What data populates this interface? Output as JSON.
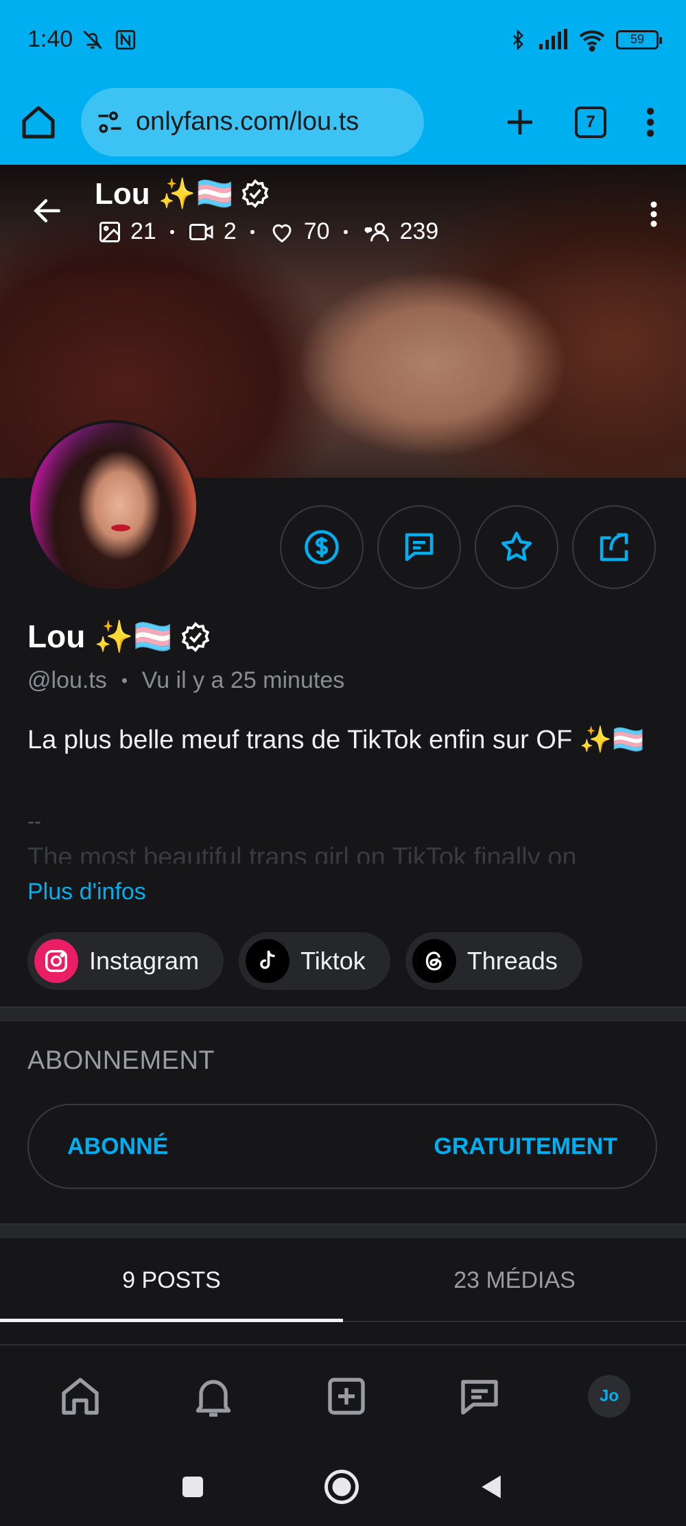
{
  "status_bar": {
    "time": "1:40",
    "battery": "59",
    "icons": [
      "bell-off-icon",
      "nfc-icon",
      "bluetooth-icon",
      "signal-icon",
      "wifi-icon",
      "battery-icon"
    ]
  },
  "browser": {
    "url": "onlyfans.com/lou.ts",
    "tab_count": "7"
  },
  "cover": {
    "name": "Lou ✨🏳️‍⚧️",
    "stats": {
      "photos": "21",
      "videos": "2",
      "likes": "70",
      "fans": "239"
    }
  },
  "profile": {
    "name": "Lou ✨🏳️‍⚧️",
    "handle": "@lou.ts",
    "last_seen": "Vu  il y a 25 minutes",
    "bio_line1": "La plus belle meuf trans de TikTok enfin sur OF ✨🏳️‍⚧️",
    "bio_separator": "--",
    "bio_faded": "The most beautiful trans girl on TikTok finally on",
    "more_link": "Plus d'infos"
  },
  "socials": [
    {
      "label": "Instagram",
      "icon": "instagram-icon"
    },
    {
      "label": "Tiktok",
      "icon": "tiktok-icon"
    },
    {
      "label": "Threads",
      "icon": "threads-icon"
    }
  ],
  "subscription": {
    "title": "ABONNEMENT",
    "status": "ABONNÉ",
    "price": "GRATUITEMENT"
  },
  "tabs": [
    {
      "label": "9 POSTS",
      "active": true
    },
    {
      "label": "23 MÉDIAS",
      "active": false
    }
  ],
  "bottom_nav": {
    "avatar_initials": "Jo"
  },
  "colors": {
    "accent": "#00aff0",
    "background": "#161618",
    "muted": "#8a8c94"
  }
}
